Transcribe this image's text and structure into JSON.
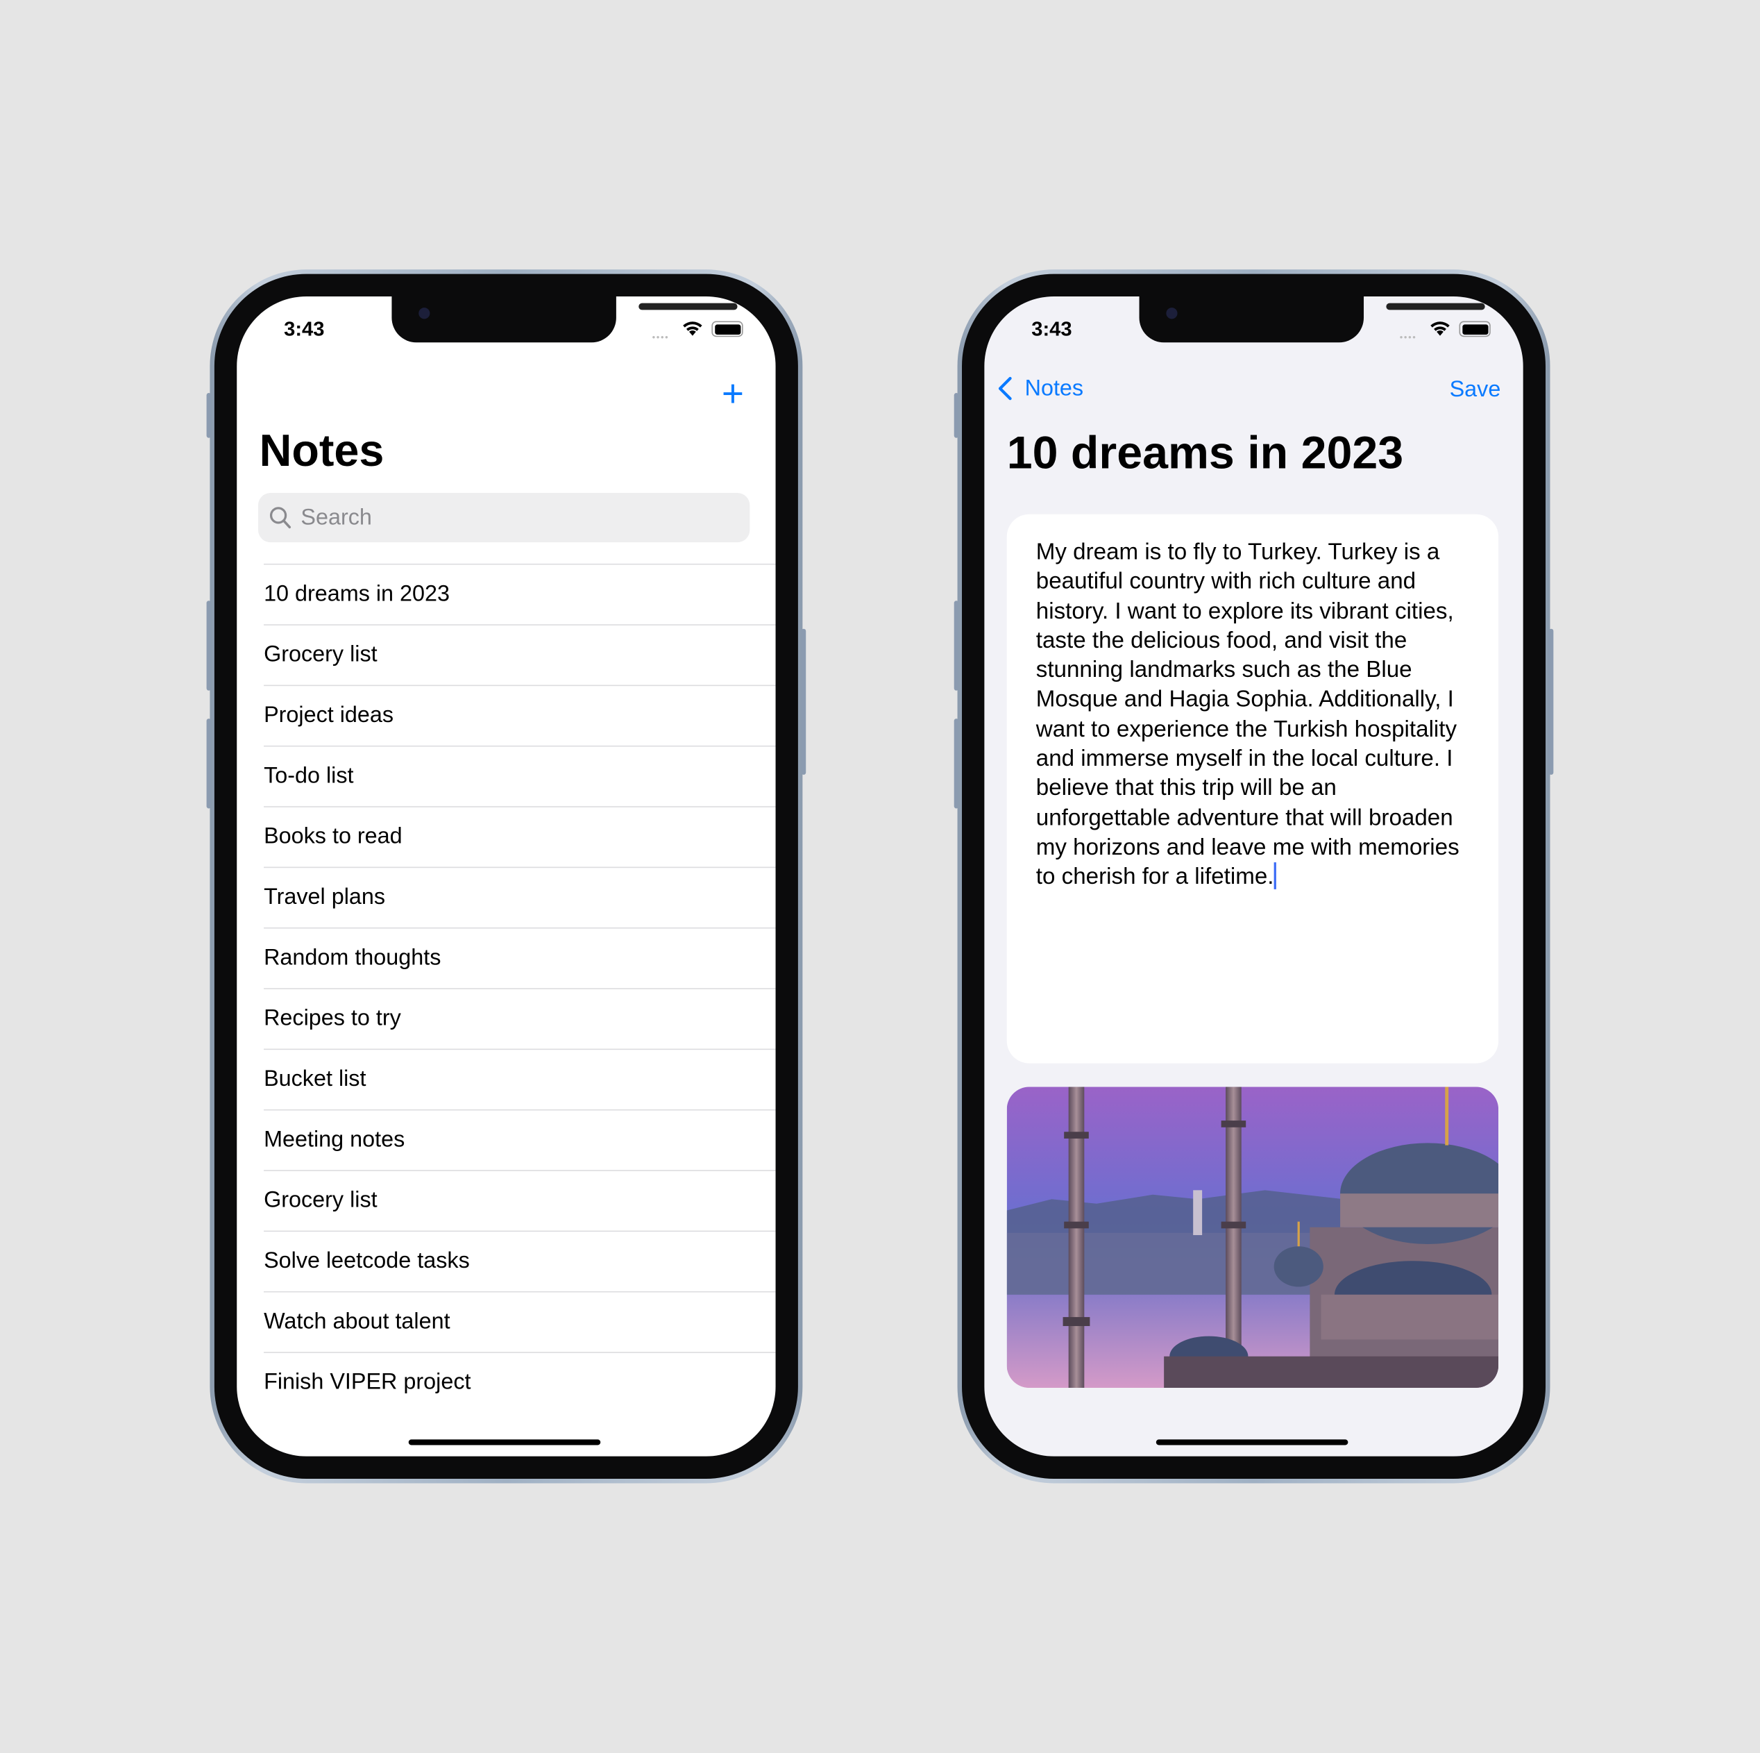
{
  "status_bar": {
    "time": "3:43"
  },
  "list_screen": {
    "add_icon": "plus-icon",
    "title": "Notes",
    "search": {
      "placeholder": "Search",
      "value": ""
    },
    "notes": [
      "10 dreams in 2023",
      "Grocery list",
      "Project ideas",
      "To-do list",
      "Books to read",
      "Travel plans",
      "Random thoughts",
      "Recipes to try",
      "Bucket list",
      "Meeting notes",
      "Grocery list",
      "Solve leetcode tasks",
      "Watch about talent",
      "Finish VIPER project"
    ]
  },
  "detail_screen": {
    "back_label": "Notes",
    "save_label": "Save",
    "title": "10 dreams in 2023",
    "body": "My dream is to fly to Turkey. Turkey is a beautiful country with rich culture and history. I want to explore its vibrant cities, taste the delicious food, and visit the stunning landmarks such as the Blue Mosque and Hagia Sophia. Additionally, I want to experience the Turkish hospitality and immerse myself in the local culture. I believe that this trip will be an unforgettable adventure that will broaden my horizons and leave me with memories to cherish for a lifetime.",
    "image": "blue-mosque-photo"
  },
  "colors": {
    "accent": "#0a7aff",
    "background": "#e5e5e5",
    "detail_background": "#f2f2f7",
    "caret": "#3b6cf6"
  }
}
